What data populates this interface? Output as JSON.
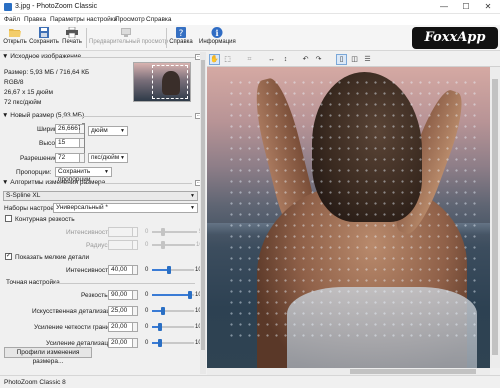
{
  "window": {
    "title": "3.jpg - PhotoZoom Classic",
    "min": "—",
    "max": "☐",
    "close": "✕"
  },
  "menu": [
    "Файл",
    "Правка",
    "Параметры настройки",
    "Просмотр",
    "Справка"
  ],
  "toolbar": {
    "open": "Открыть",
    "save": "Сохранить",
    "print": "Печать",
    "preview": "Предварительный просмотр",
    "help": "Справка",
    "info": "Информация"
  },
  "watermark": "FoxxApp",
  "source": {
    "header": "Исходное изображение",
    "size": "Размер: 5,93 МБ / 716,64 КБ",
    "mode": "RGB/8",
    "dims": "26,67 x 15 дюйм",
    "res": "72 пкс/дюйм"
  },
  "new_size": {
    "header": "Новый размер (5,93 МБ)",
    "width_label": "Ширина:",
    "width_value": "26,6667",
    "height_label": "Высота:",
    "height_value": "15",
    "unit": "дюйм",
    "res_label": "Разрешение:",
    "res_value": "72",
    "res_unit": "пкс/дюйм",
    "prop_label": "Пропорции:",
    "prop_value": "Сохранить пропорции"
  },
  "algorithms": {
    "header": "Алгоритмы изменения размера",
    "method": "S-Spline XL",
    "preset_label": "Наборы настроек:",
    "preset_value": "Универсальный *",
    "contour_label": "Контурная резкость",
    "contour_checked": false,
    "intensity_label": "Интенсивность:",
    "intensity_min": "0",
    "intensity_max": "5",
    "radius_label": "Радиус:",
    "radius_min": "0",
    "radius_max": "10",
    "details_label": "Показать мелкие детали",
    "details_checked": true,
    "details_intensity_label": "Интенсивность:",
    "details_intensity_value": "40,00",
    "details_min": "0",
    "details_max": "100",
    "details_level": 0.4
  },
  "fine_tune": {
    "header": "Точная настройка",
    "rows": [
      {
        "label": "Резкость:",
        "value": "90,00",
        "min": "0",
        "max": "100",
        "level": 0.9
      },
      {
        "label": "Искусственная детализация:",
        "value": "25,00",
        "min": "0",
        "max": "100",
        "level": 0.25
      },
      {
        "label": "Усиление четкости границ:",
        "value": "20,00",
        "min": "0",
        "max": "100",
        "level": 0.2
      },
      {
        "label": "Усиление детализации:",
        "value": "20,00",
        "min": "0",
        "max": "100",
        "level": 0.2
      }
    ]
  },
  "profile_button": "Профили изменения размера...",
  "status": "PhotoZoom Classic 8"
}
